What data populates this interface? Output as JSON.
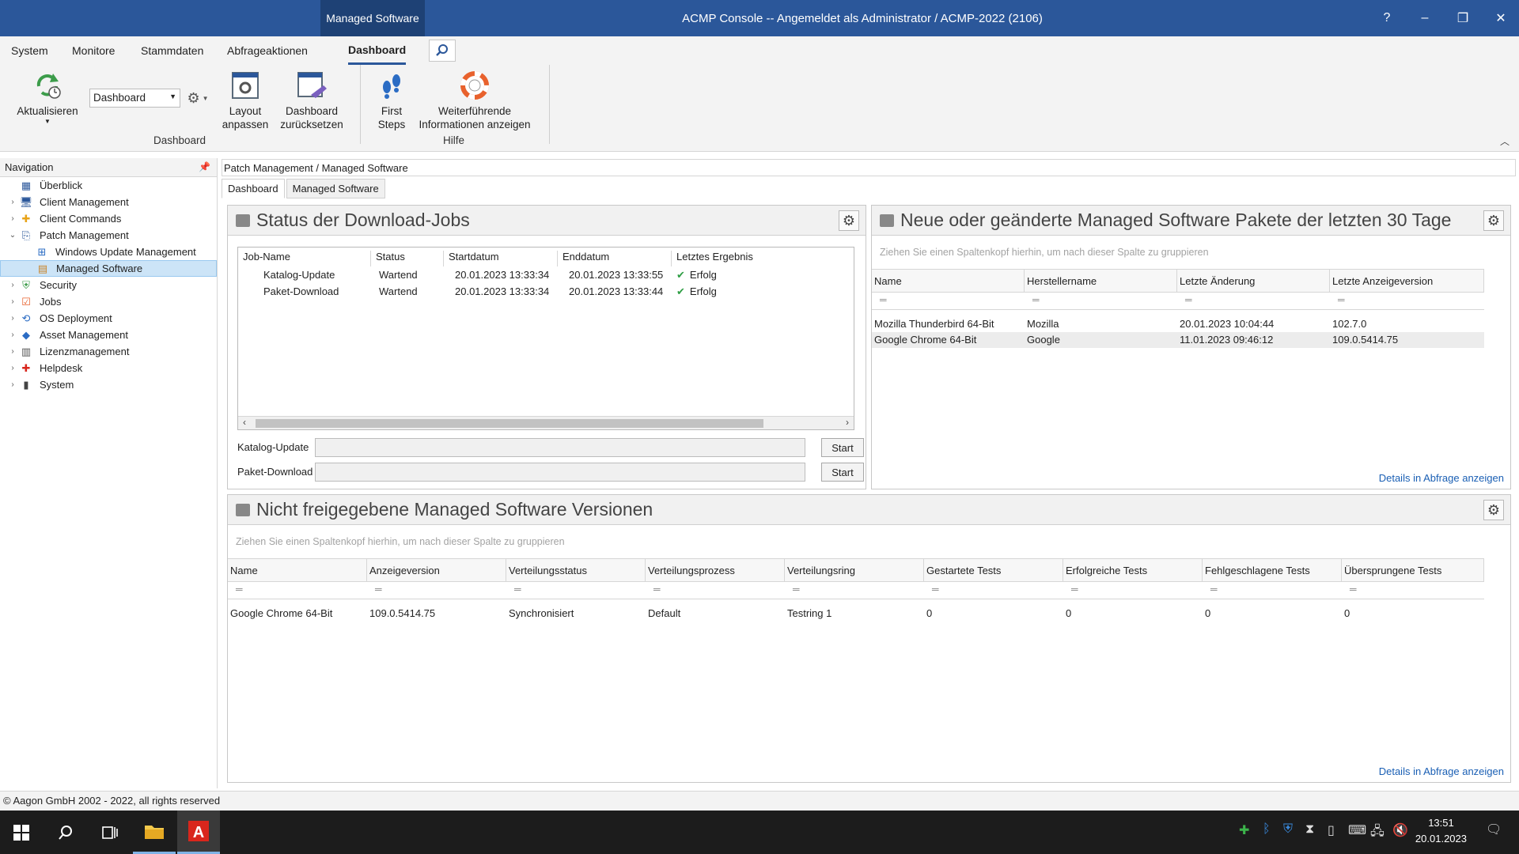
{
  "titlebar": {
    "context_tab": "Managed Software",
    "title": "ACMP Console -- Angemeldet als Administrator / ACMP-2022 (2106)",
    "help": "?",
    "minimize": "–",
    "restore": "❐",
    "close": "✕"
  },
  "menu": {
    "tabs": [
      "System",
      "Monitore",
      "Stammdaten",
      "Abfrageaktionen",
      "Dashboard"
    ],
    "active": "Dashboard"
  },
  "ribbon": {
    "refresh_label": "Aktualisieren",
    "dashboard_select": "Dashboard",
    "layout_label_1": "Layout",
    "layout_label_2": "anpassen",
    "reset_label_1": "Dashboard",
    "reset_label_2": "zurücksetzen",
    "firststeps_label_1": "First",
    "firststeps_label_2": "Steps",
    "info_label_1": "Weiterführende",
    "info_label_2": "Informationen anzeigen",
    "group_dashboard": "Dashboard",
    "group_help": "Hilfe"
  },
  "navigation": {
    "header": "Navigation",
    "items": [
      {
        "label": "Überblick",
        "level": 0,
        "expander": "",
        "icon": "overview-icon"
      },
      {
        "label": "Client Management",
        "level": 0,
        "expander": "›",
        "icon": "monitor-icon"
      },
      {
        "label": "Client Commands",
        "level": 0,
        "expander": "›",
        "icon": "puzzle-icon"
      },
      {
        "label": "Patch Management",
        "level": 0,
        "expander": "⌄",
        "icon": "patch-icon"
      },
      {
        "label": "Windows Update Management",
        "level": 1,
        "expander": "",
        "icon": "windows-icon"
      },
      {
        "label": "Managed Software",
        "level": 1,
        "expander": "",
        "icon": "package-icon",
        "selected": true
      },
      {
        "label": "Security",
        "level": 0,
        "expander": "›",
        "icon": "shield-icon"
      },
      {
        "label": "Jobs",
        "level": 0,
        "expander": "›",
        "icon": "jobs-icon"
      },
      {
        "label": "OS Deployment",
        "level": 0,
        "expander": "›",
        "icon": "deployment-icon"
      },
      {
        "label": "Asset Management",
        "level": 0,
        "expander": "›",
        "icon": "asset-icon"
      },
      {
        "label": "Lizenzmanagement",
        "level": 0,
        "expander": "›",
        "icon": "license-icon"
      },
      {
        "label": "Helpdesk",
        "level": 0,
        "expander": "›",
        "icon": "helpdesk-icon"
      },
      {
        "label": "System",
        "level": 0,
        "expander": "›",
        "icon": "system-icon"
      }
    ]
  },
  "breadcrumb": "Patch Management / Managed Software",
  "content_tabs": [
    "Dashboard",
    "Managed Software"
  ],
  "panel_jobs": {
    "title": "Status der Download-Jobs",
    "columns": [
      "Job-Name",
      "Status",
      "Startdatum",
      "Enddatum",
      "Letztes Ergebnis"
    ],
    "rows": [
      [
        "Katalog-Update",
        "Wartend",
        "20.01.2023 13:33:34",
        "20.01.2023 13:33:55",
        "Erfolg"
      ],
      [
        "Paket-Download",
        "Wartend",
        "20.01.2023 13:33:34",
        "20.01.2023 13:33:44",
        "Erfolg"
      ]
    ],
    "progress": [
      {
        "label": "Katalog-Update",
        "button": "Start"
      },
      {
        "label": "Paket-Download",
        "button": "Start"
      }
    ]
  },
  "panel_new": {
    "title": "Neue oder geänderte Managed Software Pakete der letzten 30 Tage",
    "group_hint": "Ziehen Sie einen Spaltenkopf hierhin, um nach dieser Spalte zu gruppieren",
    "columns": [
      "Name",
      "Herstellername",
      "Letzte Änderung",
      "Letzte Anzeigeversion"
    ],
    "rows": [
      [
        "Mozilla Thunderbird 64-Bit",
        "Mozilla",
        "20.01.2023 10:04:44",
        "102.7.0"
      ],
      [
        "Google Chrome 64-Bit",
        "Google",
        "11.01.2023 09:46:12",
        "109.0.5414.75"
      ]
    ],
    "details_link": "Details in Abfrage anzeigen"
  },
  "panel_unreleased": {
    "title": "Nicht freigegebene Managed Software Versionen",
    "group_hint": "Ziehen Sie einen Spaltenkopf hierhin, um nach dieser Spalte zu gruppieren",
    "columns": [
      "Name",
      "Anzeigeversion",
      "Verteilungsstatus",
      "Verteilungsprozess",
      "Verteilungsring",
      "Gestartete Tests",
      "Erfolgreiche Tests",
      "Fehlgeschlagene Tests",
      "Übersprungene Tests"
    ],
    "rows": [
      [
        "Google Chrome 64-Bit",
        "109.0.5414.75",
        "Synchronisiert",
        "Default",
        "Testring 1",
        "0",
        "0",
        "0",
        "0"
      ]
    ],
    "details_link": "Details in Abfrage anzeigen"
  },
  "statusbar": "© Aagon GmbH 2002 - 2022, all rights reserved",
  "taskbar": {
    "time": "13:51",
    "date": "20.01.2023"
  }
}
